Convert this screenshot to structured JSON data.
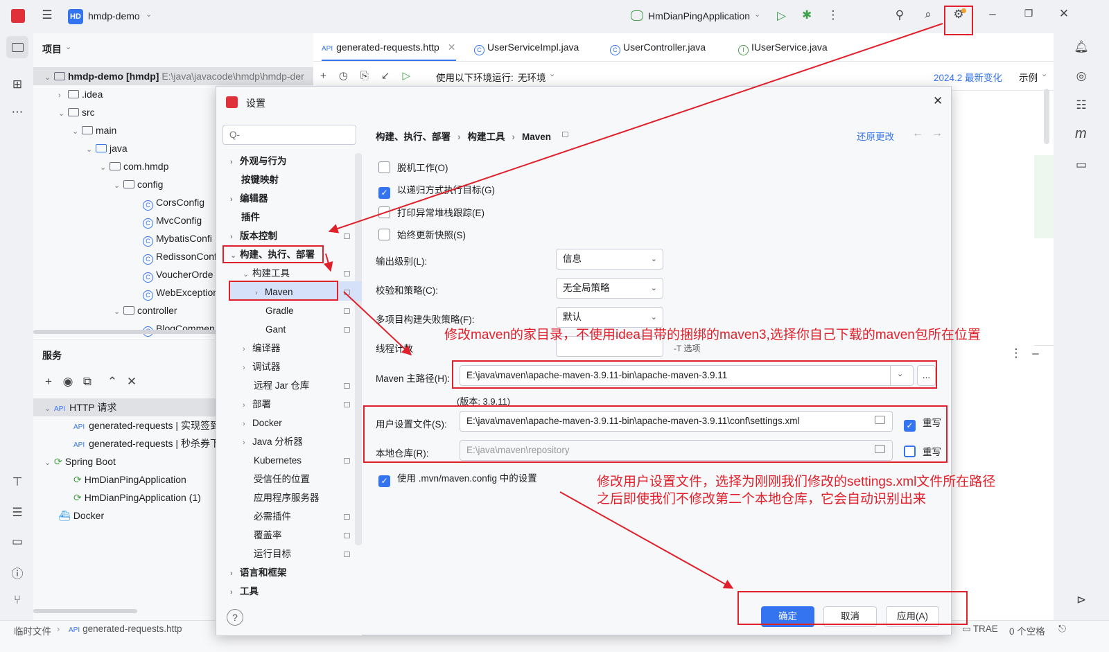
{
  "titlebar": {
    "project_badge": "HD",
    "project_name": "hmdp-demo",
    "run_config": "HmDianPingApplication"
  },
  "project_panel": {
    "header": "项目",
    "root_name": "hmdp-demo [hmdp]",
    "root_path": "E:\\java\\javacode\\hmdp\\hmdp-der",
    "items": {
      "idea": ".idea",
      "src": "src",
      "main": "main",
      "java": "java",
      "pkg": "com.hmdp",
      "config": "config",
      "cors": "CorsConfig",
      "mvc": "MvcConfig",
      "mybatis": "MybatisConfi",
      "redisson": "RedissonConf",
      "voucher": "VoucherOrde",
      "webexc": "WebException",
      "controller": "controller",
      "blog": "BlogCommen"
    }
  },
  "services_panel": {
    "header": "服务",
    "http_group": "HTTP 请求",
    "req1": "generated-requests | 实现签到",
    "req2": "generated-requests | 秒杀券下",
    "spring_group": "Spring Boot",
    "app1": "HmDianPingApplication",
    "app2": "HmDianPingApplication (1)",
    "docker": "Docker"
  },
  "editor": {
    "tabs": [
      "generated-requests.http",
      "UserServiceImpl.java",
      "UserController.java",
      "IUserService.java"
    ],
    "toolbar_env_label": "使用以下环境运行:",
    "toolbar_env_value": "无环境",
    "whats_new": "2024.2 最新变化",
    "examples": "示例"
  },
  "statusbar": {
    "crumb1": "临时文件",
    "crumb2": "generated-requests.http",
    "trae": "TRAE",
    "indent": "0 个空格"
  },
  "dialog": {
    "title": "设置",
    "search_placeholder": "Q-",
    "breadcrumb": [
      "构建、执行、部署",
      "构建工具",
      "Maven"
    ],
    "reset": "还原更改",
    "nav": {
      "appearance": "外观与行为",
      "keymap": "按键映射",
      "editor": "编辑器",
      "plugins": "插件",
      "vcs": "版本控制",
      "build": "构建、执行、部署",
      "build_tools": "构建工具",
      "maven": "Maven",
      "gradle": "Gradle",
      "gant": "Gant",
      "compiler": "编译器",
      "debugger": "调试器",
      "remote_jar": "远程 Jar 仓库",
      "deploy": "部署",
      "docker": "Docker",
      "java_profiler": "Java 分析器",
      "k8s": "Kubernetes",
      "trusted": "受信任的位置",
      "app_servers": "应用程序服务器",
      "required_plugins": "必需插件",
      "coverage": "覆盖率",
      "run_targets": "运行目标",
      "languages": "语言和框架",
      "tools": "工具"
    },
    "options": {
      "offline": "脱机工作(O)",
      "recursive": "以递归方式执行目标(G)",
      "print_trace": "打印异常堆栈跟踪(E)",
      "always_update": "始终更新快照(S)",
      "use_mvn_config": "使用 .mvn/maven.config 中的设置"
    },
    "checked": {
      "offline": false,
      "recursive": true,
      "print_trace": false,
      "always_update": false,
      "user_settings_override": true,
      "local_repo_override": false,
      "use_mvn_config": true
    },
    "output_level_label": "输出级别(L):",
    "output_level": "信息",
    "checksum_label": "校验和策略(C):",
    "checksum": "无全局策略",
    "multi_fail_label": "多项目构建失败策略(F):",
    "multi_fail": "默认",
    "thread_label": "线程计数",
    "thread_hint": "-T 选项",
    "maven_home_label": "Maven 主路径(H):",
    "maven_home": "E:\\java\\maven\\apache-maven-3.9.11-bin\\apache-maven-3.9.11",
    "version": "(版本: 3.9.11)",
    "user_settings_label": "用户设置文件(S):",
    "user_settings": "E:\\java\\maven\\apache-maven-3.9.11-bin\\apache-maven-3.9.11\\conf\\settings.xml",
    "local_repo_label": "本地仓库(R):",
    "local_repo": "E:\\java\\maven\\repository",
    "override": "重写",
    "browse": "...",
    "ok": "确定",
    "cancel": "取消",
    "apply": "应用(A)",
    "help": "?"
  },
  "annotations": {
    "note1": "修改maven的家目录，不使用idea自带的捆绑的maven3,选择你自己下载的maven包所在位置",
    "note2_line1": "修改用户设置文件，选择为刚刚我们修改的settings.xml文件所在路径",
    "note2_line2": "之后即使我们不修改第二个本地仓库，它会自动识别出来"
  }
}
